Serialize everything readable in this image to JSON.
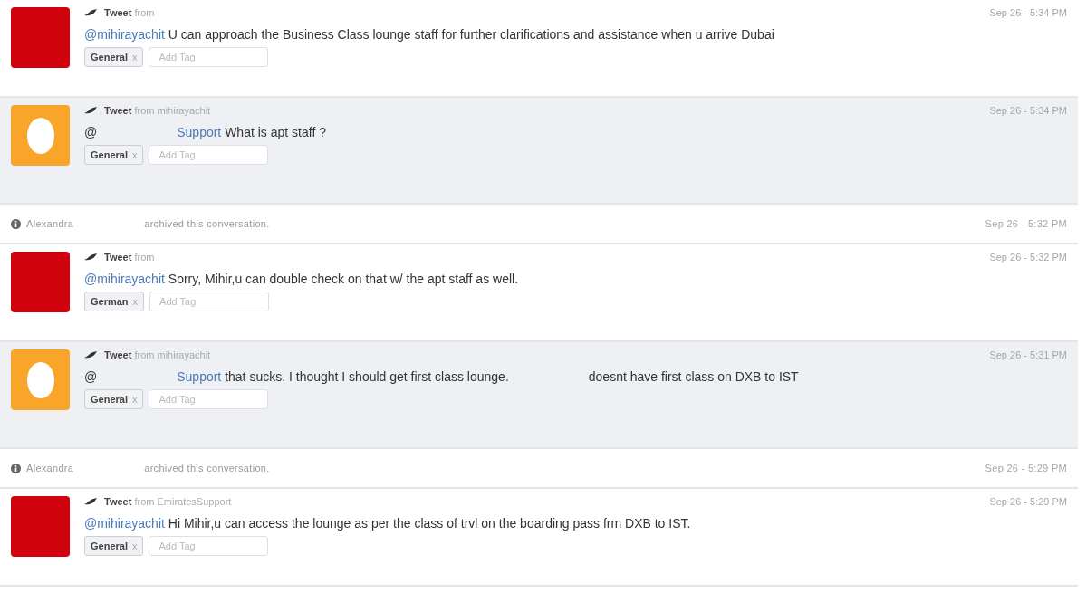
{
  "feed": [
    {
      "kind": "tweet",
      "avatar": {
        "kind": "brand"
      },
      "shaded": false,
      "source": "**Tweet** from",
      "time": "Sep 26 - 5:34 PM",
      "body": [
        {
          "kind": "link",
          "text": "@mihirayachit"
        },
        {
          "kind": "text",
          "text": " U can approach the Business Class lounge staff for further clarifications and assistance when u arrive Dubai"
        }
      ],
      "tags": [
        {
          "label": "General",
          "remove": "x"
        }
      ],
      "tag_input": {
        "placeholder": "Add Tag"
      }
    },
    {
      "kind": "tweet",
      "avatar": {
        "kind": "egg"
      },
      "shaded": true,
      "source": "**Tweet** from mihirayachit",
      "time": "Sep 26 - 5:34 PM",
      "body": [
        {
          "kind": "text",
          "text": "@"
        },
        {
          "kind": "blank"
        },
        {
          "kind": "link",
          "text": "Support"
        },
        {
          "kind": "text",
          "text": " What is apt staff ?"
        }
      ],
      "tags": [
        {
          "label": "General",
          "remove": "x"
        }
      ],
      "tag_input": {
        "placeholder": "Add Tag"
      }
    },
    {
      "kind": "event",
      "name": "Alexandra",
      "action": "archived this conversation.",
      "time": "Sep 26 - 5:32 PM"
    },
    {
      "kind": "tweet",
      "avatar": {
        "kind": "brand"
      },
      "shaded": false,
      "source": "**Tweet** from",
      "time": "Sep 26 - 5:32 PM",
      "body": [
        {
          "kind": "link",
          "text": "@mihirayachit"
        },
        {
          "kind": "text",
          "text": " Sorry, Mihir,u can double check on that w/ the apt staff as well."
        }
      ],
      "tags": [
        {
          "label": "German",
          "remove": "x"
        }
      ],
      "tag_input": {
        "placeholder": "Add Tag"
      }
    },
    {
      "kind": "tweet",
      "avatar": {
        "kind": "egg"
      },
      "shaded": true,
      "source": "**Tweet** from mihirayachit",
      "time": "Sep 26 - 5:31 PM",
      "body": [
        {
          "kind": "text",
          "text": "@"
        },
        {
          "kind": "blank"
        },
        {
          "kind": "link",
          "text": "Support"
        },
        {
          "kind": "text",
          "text": " that sucks. I thought I should get first class lounge."
        },
        {
          "kind": "blank"
        },
        {
          "kind": "text",
          "text": "doesnt have first class on DXB to IST"
        }
      ],
      "tags": [
        {
          "label": "General",
          "remove": "x"
        }
      ],
      "tag_input": {
        "placeholder": "Add Tag"
      }
    },
    {
      "kind": "event",
      "name": "Alexandra",
      "action": "archived this conversation.",
      "time": "Sep 26 - 5:29 PM"
    },
    {
      "kind": "tweet",
      "avatar": {
        "kind": "brand"
      },
      "shaded": false,
      "source": "**Tweet** from EmiratesSupport",
      "time": "Sep 26 - 5:29 PM",
      "body": [
        {
          "kind": "link",
          "text": "@mihirayachit"
        },
        {
          "kind": "text",
          "text": " Hi Mihir,u can access the lounge as per the class of trvl on the boarding pass frm DXB to IST."
        }
      ],
      "tags": [
        {
          "label": "General",
          "remove": "x"
        }
      ],
      "tag_input": {
        "placeholder": "Add Tag"
      }
    }
  ]
}
